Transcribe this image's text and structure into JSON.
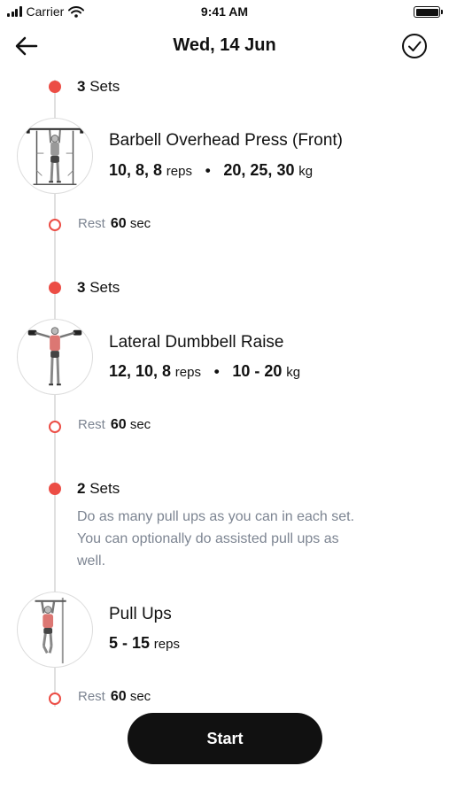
{
  "status_bar": {
    "carrier": "Carrier",
    "time": "9:41 AM",
    "icons": [
      "signal-icon",
      "wifi-icon",
      "battery-icon"
    ]
  },
  "header": {
    "title": "Wed, 14 Jun",
    "back_icon": "arrow-left-icon",
    "done_icon": "check-circle-icon"
  },
  "workout": [
    {
      "sets_count": "3",
      "sets_label": "Sets",
      "exercise_name": "Barbell Overhead Press (Front)",
      "reps": "10, 8, 8",
      "reps_unit": "reps",
      "separator": "•",
      "weight": "20, 25, 30",
      "weight_unit": "kg",
      "rest_label": "Rest",
      "rest_value": "60",
      "rest_unit": "sec"
    },
    {
      "sets_count": "3",
      "sets_label": "Sets",
      "exercise_name": "Lateral Dumbbell Raise",
      "reps": "12, 10, 8",
      "reps_unit": "reps",
      "separator": "•",
      "weight": "10 - 20",
      "weight_unit": "kg",
      "rest_label": "Rest",
      "rest_value": "60",
      "rest_unit": "sec"
    },
    {
      "sets_count": "2",
      "sets_label": "Sets",
      "note_line1": "Do as many pull ups as you can in each set.",
      "note_line2": "You can optionally do assisted pull ups as",
      "note_line3": "well.",
      "exercise_name": "Pull Ups",
      "reps": "5 - 15",
      "reps_unit": "reps",
      "rest_label": "Rest",
      "rest_value": "60",
      "rest_unit": "sec"
    }
  ],
  "start_button": {
    "label": "Start"
  },
  "colors": {
    "accent": "#ec4d45",
    "text": "#111111",
    "muted": "#7d8592",
    "timeline": "#e0e0e0",
    "button_bg": "#111111"
  }
}
